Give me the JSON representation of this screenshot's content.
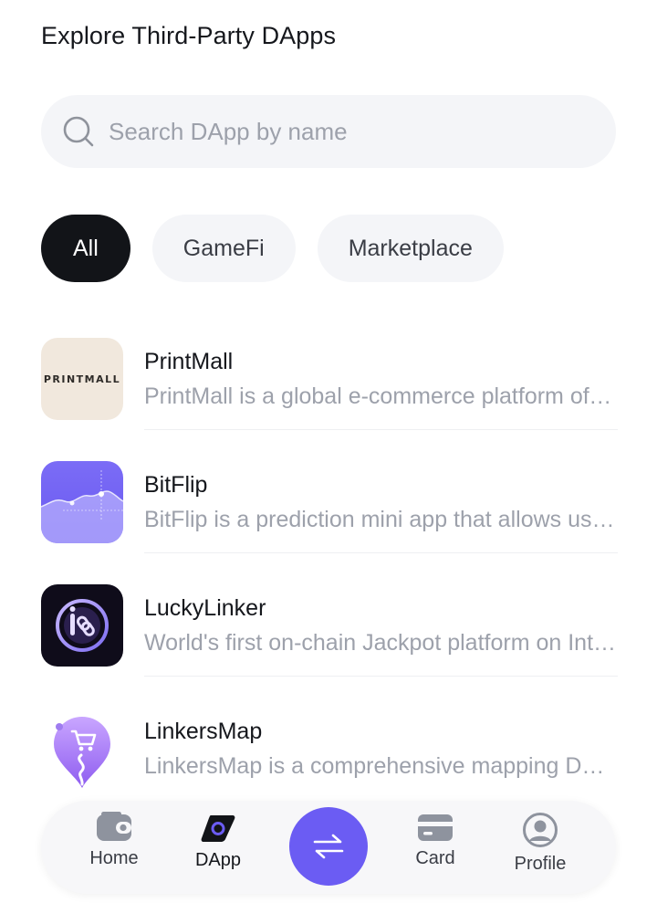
{
  "header": {
    "title": "Explore Third-Party DApps"
  },
  "search": {
    "placeholder": "Search DApp by name",
    "value": ""
  },
  "filters": [
    {
      "label": "All",
      "active": true
    },
    {
      "label": "GameFi",
      "active": false
    },
    {
      "label": "Marketplace",
      "active": false
    }
  ],
  "dapps": [
    {
      "name": "PrintMall",
      "description": "PrintMall is a global e-commerce platform offe...",
      "icon": "printmall-logo",
      "logo_text": "PRINTMALL"
    },
    {
      "name": "BitFlip",
      "description": "BitFlip is a prediction mini app that allows user...",
      "icon": "bitflip-logo"
    },
    {
      "name": "LuckyLinker",
      "description": "World's first on-chain Jackpot platform on Inte...",
      "icon": "luckylinker-logo"
    },
    {
      "name": "LinkersMap",
      "description": "LinkersMap is a comprehensive mapping DAp...",
      "icon": "linkersmap-logo"
    }
  ],
  "tabbar": {
    "home": "Home",
    "dapp": "DApp",
    "swap_icon": "swap-icon",
    "card": "Card",
    "profile": "Profile",
    "active": "DApp"
  },
  "colors": {
    "accent": "#6b5cf3",
    "active_chip": "#121418",
    "muted_text": "#9da1ab"
  }
}
